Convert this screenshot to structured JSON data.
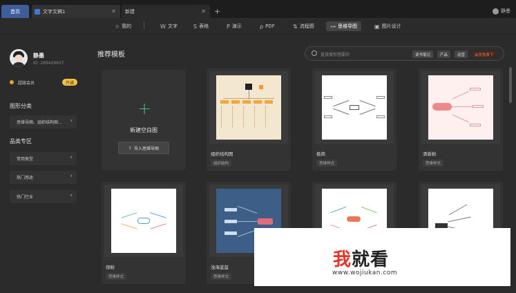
{
  "tabs": [
    {
      "label": "首页"
    },
    {
      "label": "文字文稿1"
    },
    {
      "label": "新建"
    }
  ],
  "user": {
    "short_name": "静墨",
    "name": "静墨",
    "id": "ID: 269429637"
  },
  "toolbar": [
    {
      "label": "我的",
      "icon": "star-icon"
    },
    {
      "label": "文字",
      "icon": "w-icon"
    },
    {
      "label": "表格",
      "icon": "s-icon"
    },
    {
      "label": "演示",
      "icon": "p-icon"
    },
    {
      "label": "PDF",
      "icon": "pdf-icon"
    },
    {
      "label": "流程图",
      "icon": "flow-icon"
    },
    {
      "label": "思维导图",
      "icon": "mindmap-icon"
    },
    {
      "label": "图片设计",
      "icon": "image-icon"
    }
  ],
  "sidebar": {
    "vip_label": "超级会员",
    "vip_button": "开通",
    "section1": "图形分类",
    "section1_item": "思维导图、组织结构图...",
    "section2": "品类专区",
    "section2_items": [
      "常用类型",
      "热门用途",
      "热门行业"
    ]
  },
  "main": {
    "title": "推荐模板",
    "search_placeholder": "直接搜你想要的",
    "chips": [
      "读书笔记",
      "产品",
      "运营",
      "会员免费下"
    ],
    "blank_label": "新建空白图",
    "import_label": "导入思维导图"
  },
  "cards": [
    {
      "title": "组织结构图",
      "tag": "组织结构"
    },
    {
      "title": "极简",
      "tag": "思维样式"
    },
    {
      "title": "清新粉",
      "tag": "思维样式"
    },
    {
      "title": "烦粉",
      "tag": "思维样式"
    },
    {
      "title": "浅海蓝蓝",
      "tag": "思维样式"
    }
  ],
  "watermark": {
    "brand_1": "我",
    "brand_2": "就看",
    "url": "www.wojiukan.com"
  }
}
